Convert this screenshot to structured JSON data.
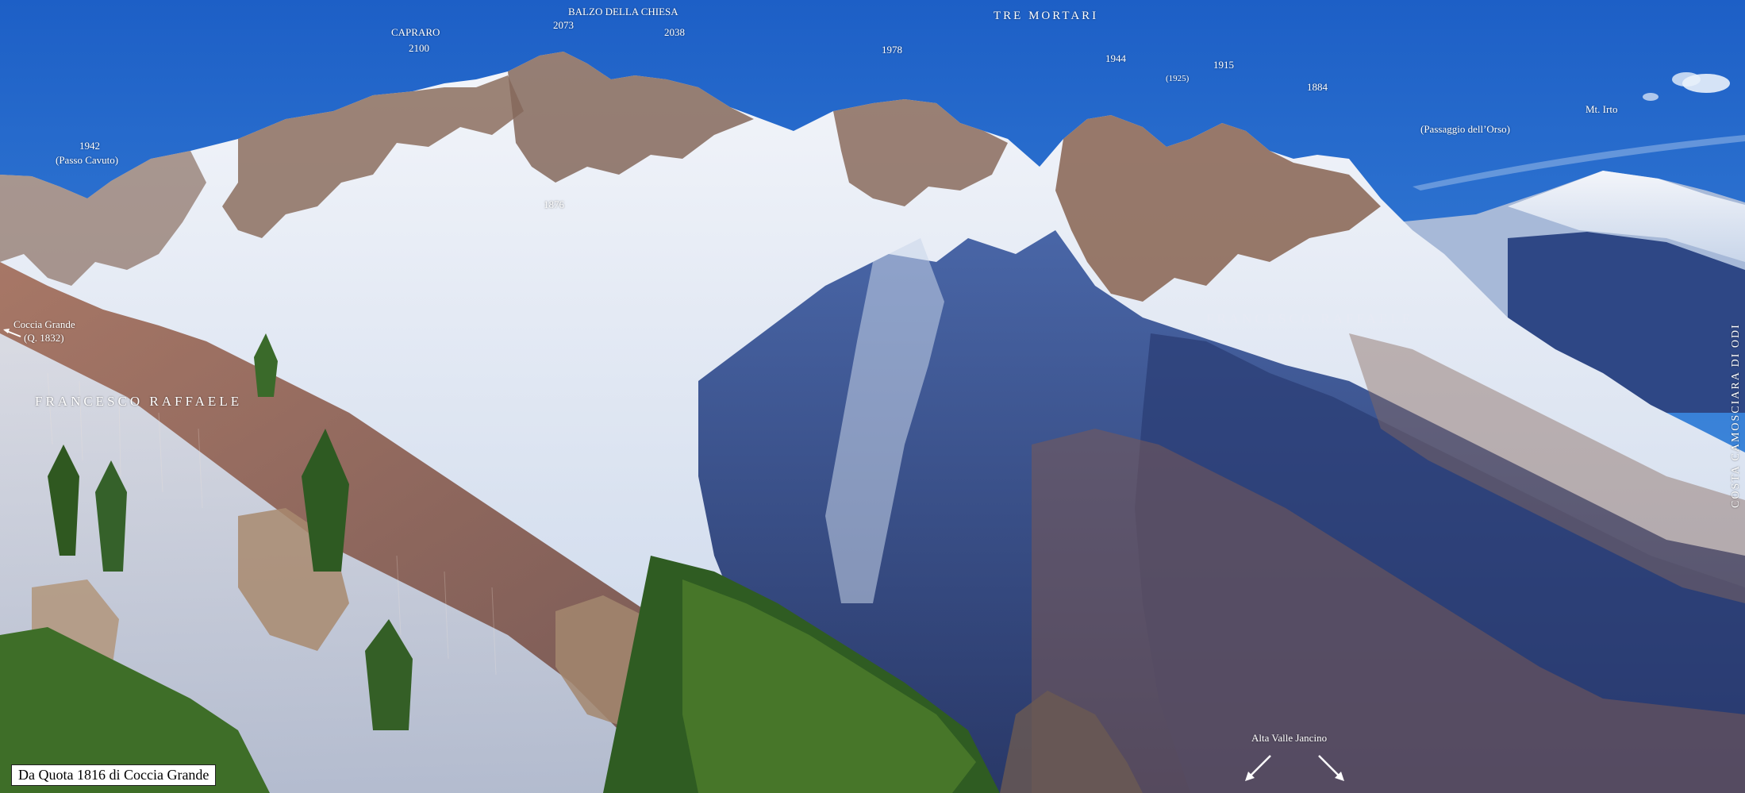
{
  "labels": {
    "tre_mortari": "TRE MORTARI",
    "balzo": "BALZO DELLA CHIESA",
    "q2073": "2073",
    "q2038": "2038",
    "capraro": "CAPRARO",
    "q2100": "2100",
    "q1978": "1978",
    "q1944": "1944",
    "q1925": "(1925)",
    "q1915": "1915",
    "q1884": "1884",
    "q1942": "1942",
    "passo_cavuto": "(Passo Cavuto)",
    "q1876": "1876",
    "passaggio_orso": "(Passaggio dell’Orso)",
    "mt_irto": "Mt. Irto",
    "coccia_grande": "Coccia Grande",
    "q1832": "(Q. 1832)",
    "author_left": "FRANCESCO RAFFAELE",
    "author_right": "FRANCESCO RAFFAELE",
    "costa": "COSTA CAMOSCIARA DI ODI",
    "alta_valle": "Alta Valle Jancino"
  },
  "caption": "Da Quota 1816 di Coccia Grande",
  "colors": {
    "sky_top": "#1f63c9",
    "sky_bottom": "#6aaeea",
    "snow": "#e8eef6",
    "rock": "#8a6c5c",
    "shadow": "#2a3f7a",
    "forest_brown": "#9a6a55",
    "pine": "#3c6a26"
  }
}
